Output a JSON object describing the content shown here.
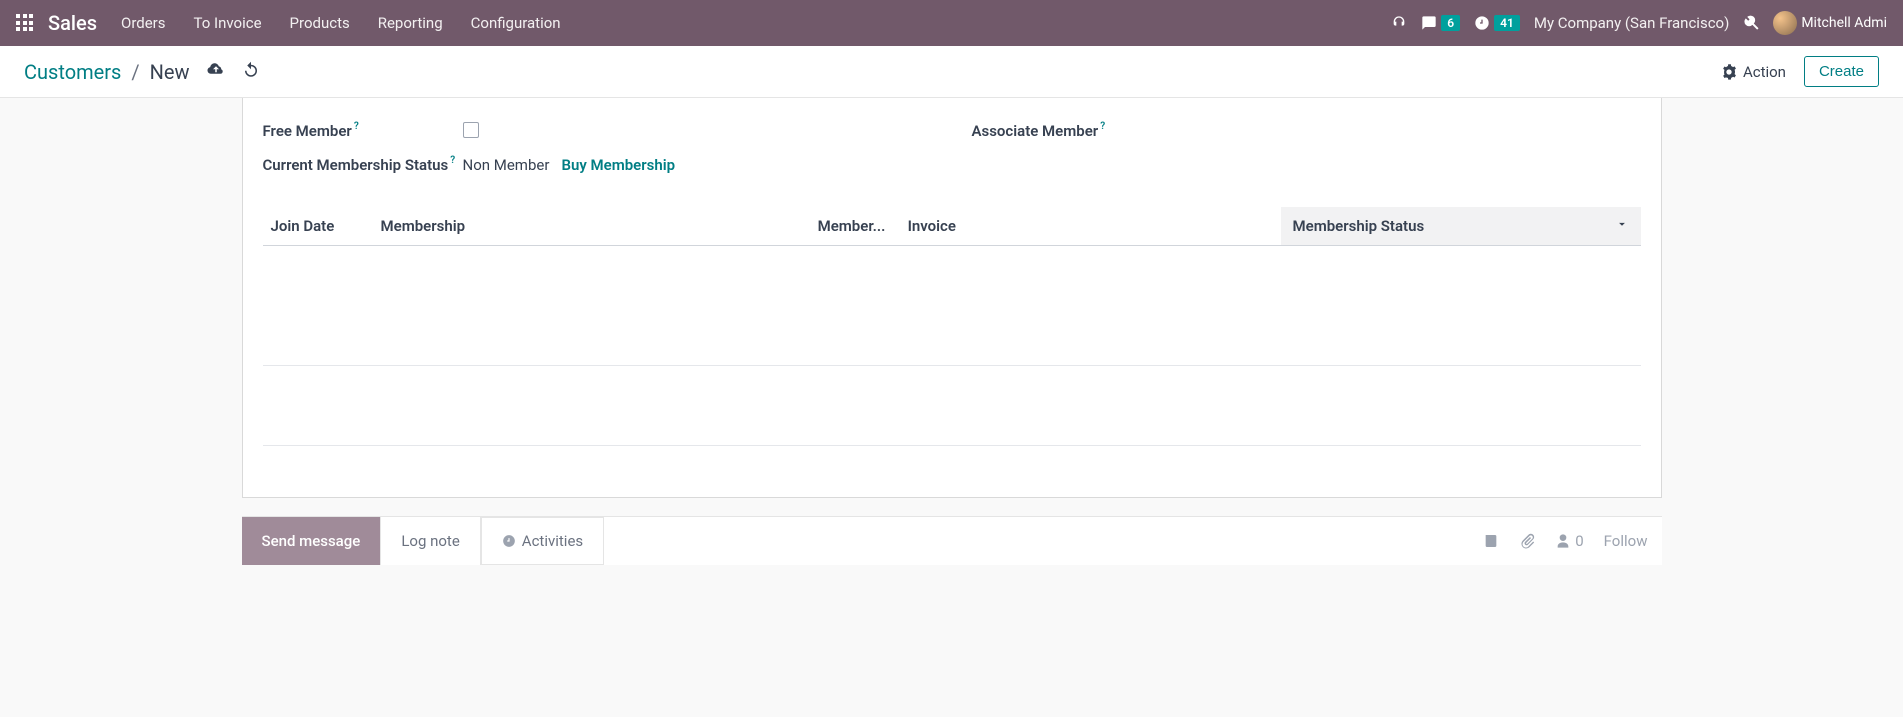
{
  "topbar": {
    "brand": "Sales",
    "nav": [
      "Orders",
      "To Invoice",
      "Products",
      "Reporting",
      "Configuration"
    ],
    "messages_badge": "6",
    "activities_badge": "41",
    "company": "My Company (San Francisco)",
    "username": "Mitchell Admi"
  },
  "breadcrumb": {
    "parent": "Customers",
    "current": "New"
  },
  "actions": {
    "action_label": "Action",
    "create_label": "Create"
  },
  "form": {
    "free_member_label": "Free Member",
    "associate_member_label": "Associate Member",
    "current_status_label": "Current Membership Status",
    "current_status_value": "Non Member",
    "buy_membership": "Buy Membership",
    "help_q": "?"
  },
  "table": {
    "headers": {
      "join_date": "Join Date",
      "membership": "Membership",
      "member": "Member...",
      "invoice": "Invoice",
      "status": "Membership Status"
    }
  },
  "chatter": {
    "send_message": "Send message",
    "log_note": "Log note",
    "activities": "Activities",
    "follower_count": "0",
    "follow": "Follow"
  }
}
